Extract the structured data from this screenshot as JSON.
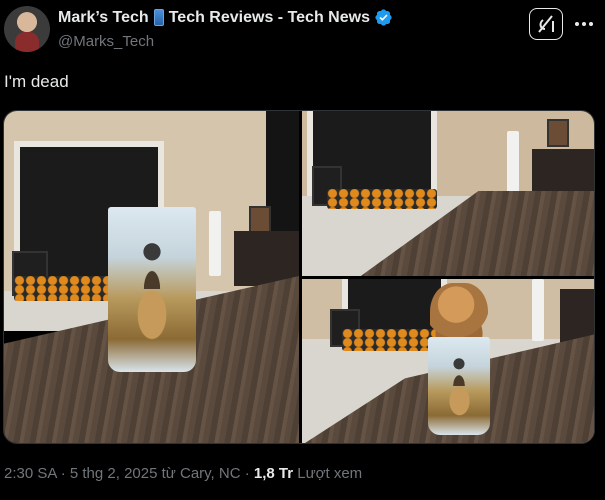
{
  "author": {
    "display_name": "Mark’s Tech",
    "display_name_suffix": "Tech Reviews - Tech News",
    "handle": "@Marks_Tech",
    "verified": true,
    "badge_color": "#1d9bf0"
  },
  "tweet": {
    "text": "I'm dead"
  },
  "meta": {
    "timestamp": "2:30 SA · 5 thg 2, 2025 từ Cary, NC",
    "separator": " · ",
    "views_count": "1,8 Tr",
    "views_label": "Lượt xem"
  },
  "icons": {
    "grok": "grok-icon",
    "more": "more-icon",
    "phone": "mobile-phone-icon",
    "verified": "verified-badge-icon"
  },
  "colors": {
    "background": "#000000",
    "text_primary": "#e7e9ea",
    "text_secondary": "#71767b"
  }
}
